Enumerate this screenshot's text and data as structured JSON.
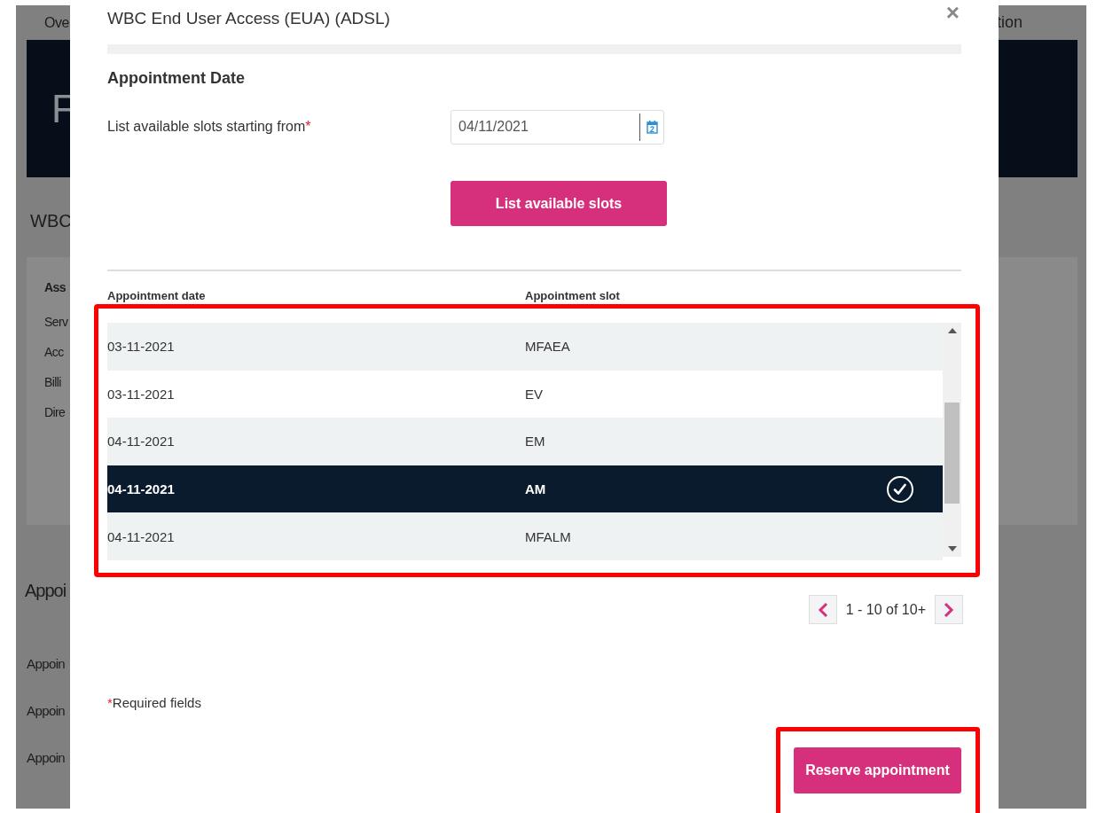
{
  "background_page": {
    "tab_left": "Ove",
    "tab_right": "tion",
    "banner_title": "F",
    "section_title": "WBC",
    "panel": {
      "heading": "Ass",
      "items": [
        "Serv",
        "Acc",
        "Billi",
        "Dire"
      ]
    },
    "appointment_heading": "Appoi",
    "appointment_labels": [
      "Appoin",
      "Appoin",
      "Appoin"
    ]
  },
  "modal": {
    "title": "WBC End User Access (EUA) (ADSL)",
    "close": "×",
    "section_title": "Appointment Date",
    "date_field": {
      "label": "List available slots starting from",
      "required_mark": "*",
      "value": "04/11/2021"
    },
    "list_button": "List available slots",
    "table": {
      "columns": [
        "Appointment date",
        "Appointment slot"
      ],
      "rows": [
        {
          "date": "03-11-2021",
          "slot": "MFAEA",
          "selected": false
        },
        {
          "date": "03-11-2021",
          "slot": "EV",
          "selected": false
        },
        {
          "date": "04-11-2021",
          "slot": "EM",
          "selected": false
        },
        {
          "date": "04-11-2021",
          "slot": "AM",
          "selected": true
        },
        {
          "date": "04-11-2021",
          "slot": "MFALM",
          "selected": false
        }
      ]
    },
    "pagination": "1 - 10 of 10+",
    "required_note": {
      "mark": "*",
      "text": "Required fields"
    },
    "reserve_button": "Reserve appointment"
  }
}
